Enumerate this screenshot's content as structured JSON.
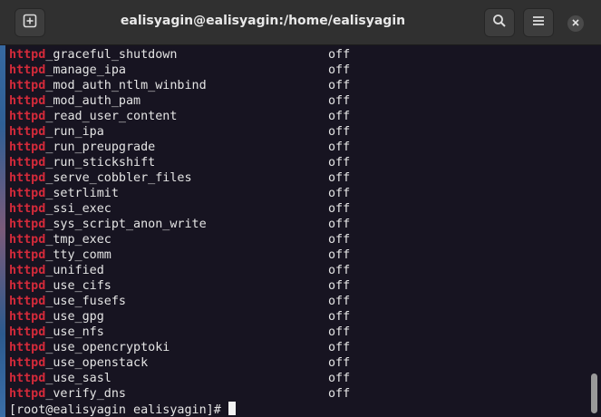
{
  "window": {
    "title": "ealisyagin@ealisyagin:/home/ealisyagin"
  },
  "icons": {
    "new_tab": "new-tab-plus-icon",
    "search": "search-icon",
    "menu": "hamburger-menu-icon",
    "close": "close-icon"
  },
  "colors": {
    "keyword": "#d42a3a",
    "text": "#e4e4e4",
    "background": "#171421",
    "titlebar": "#303030"
  },
  "terminal": {
    "keyword": "httpd",
    "rows": [
      {
        "prefix": "httpd",
        "suffix": "_graceful_shutdown",
        "state": "off"
      },
      {
        "prefix": "httpd",
        "suffix": "_manage_ipa",
        "state": "off"
      },
      {
        "prefix": "httpd",
        "suffix": "_mod_auth_ntlm_winbind",
        "state": "off"
      },
      {
        "prefix": "httpd",
        "suffix": "_mod_auth_pam",
        "state": "off"
      },
      {
        "prefix": "httpd",
        "suffix": "_read_user_content",
        "state": "off"
      },
      {
        "prefix": "httpd",
        "suffix": "_run_ipa",
        "state": "off"
      },
      {
        "prefix": "httpd",
        "suffix": "_run_preupgrade",
        "state": "off"
      },
      {
        "prefix": "httpd",
        "suffix": "_run_stickshift",
        "state": "off"
      },
      {
        "prefix": "httpd",
        "suffix": "_serve_cobbler_files",
        "state": "off"
      },
      {
        "prefix": "httpd",
        "suffix": "_setrlimit",
        "state": "off"
      },
      {
        "prefix": "httpd",
        "suffix": "_ssi_exec",
        "state": "off"
      },
      {
        "prefix": "httpd",
        "suffix": "_sys_script_anon_write",
        "state": "off"
      },
      {
        "prefix": "httpd",
        "suffix": "_tmp_exec",
        "state": "off"
      },
      {
        "prefix": "httpd",
        "suffix": "_tty_comm",
        "state": "off"
      },
      {
        "prefix": "httpd",
        "suffix": "_unified",
        "state": "off"
      },
      {
        "prefix": "httpd",
        "suffix": "_use_cifs",
        "state": "off"
      },
      {
        "prefix": "httpd",
        "suffix": "_use_fusefs",
        "state": "off"
      },
      {
        "prefix": "httpd",
        "suffix": "_use_gpg",
        "state": "off"
      },
      {
        "prefix": "httpd",
        "suffix": "_use_nfs",
        "state": "off"
      },
      {
        "prefix": "httpd",
        "suffix": "_use_opencryptoki",
        "state": "off"
      },
      {
        "prefix": "httpd",
        "suffix": "_use_openstack",
        "state": "off"
      },
      {
        "prefix": "httpd",
        "suffix": "_use_sasl",
        "state": "off"
      },
      {
        "prefix": "httpd",
        "suffix": "_verify_dns",
        "state": "off"
      }
    ],
    "prompt": "[root@ealisyagin ealisyagin]# "
  }
}
